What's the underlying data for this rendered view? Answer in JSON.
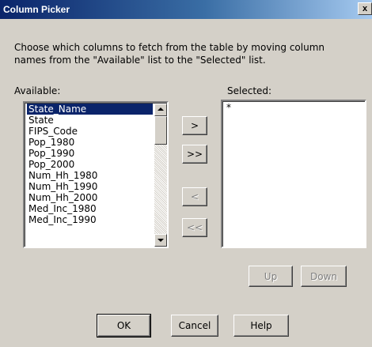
{
  "window": {
    "title": "Column Picker",
    "close_glyph": "x"
  },
  "instructions": "Choose which columns to fetch from the table by moving column\nnames from the \"Available\" list to the \"Selected\" list.",
  "available": {
    "label": "Available:",
    "items": [
      "State_Name",
      "State",
      "FIPS_Code",
      "Pop_1980",
      "Pop_1990",
      "Pop_2000",
      "Num_Hh_1980",
      "Num_Hh_1990",
      "Num_Hh_2000",
      "Med_Inc_1980",
      "Med_Inc_1990"
    ],
    "selected_index": 0
  },
  "selected": {
    "label": "Selected:",
    "items": [
      "*"
    ]
  },
  "move_buttons": {
    "add": ">",
    "add_all": ">>",
    "remove": "<",
    "remove_all": "<<"
  },
  "order_buttons": {
    "up": "Up",
    "down": "Down"
  },
  "dialog_buttons": {
    "ok": "OK",
    "cancel": "Cancel",
    "help": "Help"
  },
  "colors": {
    "title_bar": "#0a246a",
    "selection": "#0a246a",
    "face": "#d4d0c8"
  }
}
